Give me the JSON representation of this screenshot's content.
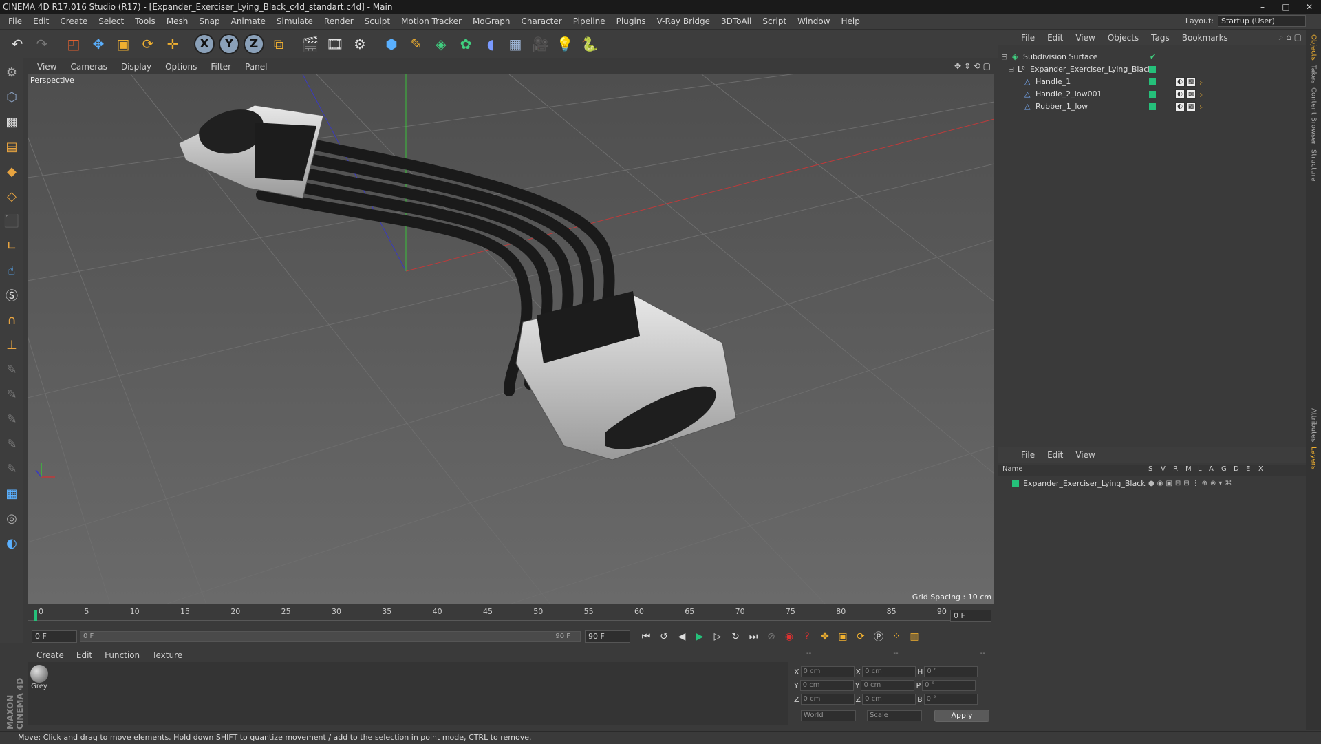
{
  "window": {
    "title": "CINEMA 4D R17.016 Studio (R17) - [Expander_Exerciser_Lying_Black_c4d_standart.c4d] - Main",
    "controls": [
      "–",
      "□",
      "✕"
    ]
  },
  "menubar": {
    "items": [
      "File",
      "Edit",
      "Create",
      "Select",
      "Tools",
      "Mesh",
      "Snap",
      "Animate",
      "Simulate",
      "Render",
      "Sculpt",
      "Motion Tracker",
      "MoGraph",
      "Character",
      "Pipeline",
      "Plugins",
      "V-Ray Bridge",
      "3DToAll",
      "Script",
      "Window",
      "Help"
    ],
    "layout_label": "Layout:",
    "layout_value": "Startup (User)"
  },
  "toolbar": {
    "axes": [
      "X",
      "Y",
      "Z"
    ]
  },
  "viewport": {
    "menu": [
      "View",
      "Cameras",
      "Display",
      "Options",
      "Filter",
      "Panel"
    ],
    "label": "Perspective",
    "grid_spacing": "Grid Spacing : 10 cm"
  },
  "timeline": {
    "ticks": [
      "0",
      "5",
      "10",
      "15",
      "20",
      "25",
      "30",
      "35",
      "40",
      "45",
      "50",
      "55",
      "60",
      "65",
      "70",
      "75",
      "80",
      "85",
      "90"
    ],
    "current_frame": "0 F",
    "start_field": "0 F",
    "range_start": "0 F",
    "range_end": "90 F",
    "end_field": "90 F"
  },
  "materials": {
    "menu": [
      "Create",
      "Edit",
      "Function",
      "Texture"
    ],
    "items": [
      {
        "label": "Grey"
      }
    ]
  },
  "coordinates": {
    "headers": [
      "--",
      "--",
      "--"
    ],
    "rows": [
      {
        "a": "X",
        "av": "0 cm",
        "b": "X",
        "bv": "0 cm",
        "c": "H",
        "cv": "0 °"
      },
      {
        "a": "Y",
        "av": "0 cm",
        "b": "Y",
        "bv": "0 cm",
        "c": "P",
        "cv": "0 °"
      },
      {
        "a": "Z",
        "av": "0 cm",
        "b": "Z",
        "bv": "0 cm",
        "c": "B",
        "cv": "0 °"
      }
    ],
    "mode1": "World",
    "mode2": "Scale",
    "apply": "Apply"
  },
  "object_manager": {
    "menu": [
      "File",
      "Edit",
      "View",
      "Objects",
      "Tags",
      "Bookmarks"
    ],
    "objects": [
      {
        "name": "Subdivision Surface",
        "indent": 0
      },
      {
        "name": "Expander_Exerciser_Lying_Black",
        "indent": 1
      },
      {
        "name": "Handle_1",
        "indent": 2
      },
      {
        "name": "Handle_2_low001",
        "indent": 2
      },
      {
        "name": "Rubber_1_low",
        "indent": 2
      }
    ]
  },
  "layer_manager": {
    "menu": [
      "File",
      "Edit",
      "View"
    ],
    "columns": [
      "Name",
      "S",
      "V",
      "R",
      "M",
      "L",
      "A",
      "G",
      "D",
      "E",
      "X"
    ],
    "layers": [
      {
        "name": "Expander_Exerciser_Lying_Black"
      }
    ]
  },
  "side_tabs": [
    "Objects",
    "Takes",
    "Content Browser",
    "Structure",
    "Attributes",
    "Layers"
  ],
  "branding": "MAXON CINEMA 4D",
  "status": "Move: Click and drag to move elements. Hold down SHIFT to quantize movement / add to the selection in point mode, CTRL to remove.",
  "colors": {
    "accent_green": "#25c07a",
    "tool_orange": "#e8a440"
  }
}
